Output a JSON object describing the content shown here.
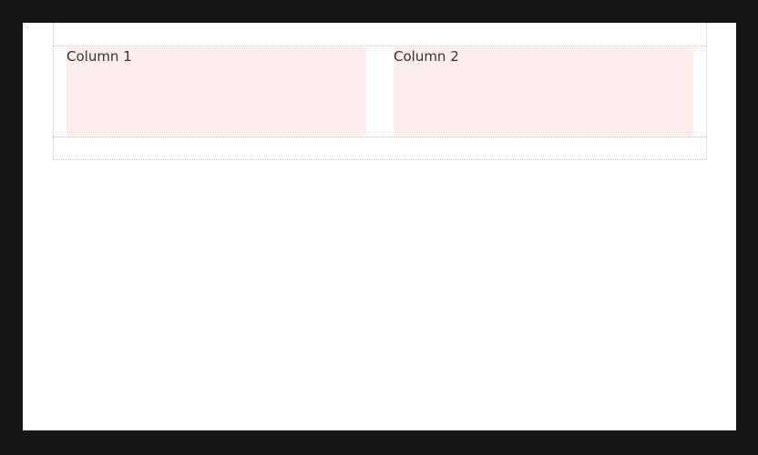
{
  "layout_section": {
    "columns": [
      {
        "label": "Column 1"
      },
      {
        "label": "Column 2"
      }
    ]
  },
  "colors": {
    "backdrop": "#161616",
    "canvas": "#ffffff",
    "column_fill": "#fdeeed",
    "outline": "#c8c8c8",
    "text": "#333333"
  }
}
